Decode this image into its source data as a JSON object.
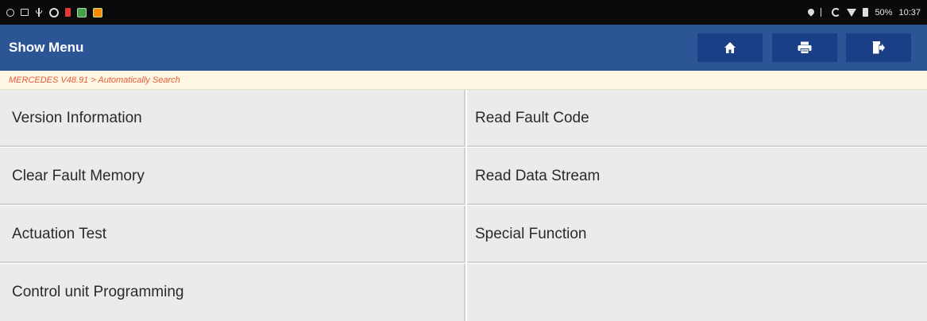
{
  "status_bar": {
    "battery_percent": "50%",
    "time": "10:37",
    "left_icons": [
      "circle-icon",
      "screen-icon",
      "usb-icon",
      "ring-icon",
      "red-battery-icon",
      "green-app-icon",
      "orange-app-icon"
    ],
    "right_icons": [
      "location-pin-icon",
      "bluetooth-icon",
      "sync-icon",
      "wifi-icon",
      "battery-icon"
    ]
  },
  "header": {
    "title": "Show Menu",
    "buttons": [
      {
        "name": "home",
        "icon": "home-icon"
      },
      {
        "name": "print",
        "icon": "print-icon"
      },
      {
        "name": "exit",
        "icon": "exit-icon"
      }
    ],
    "background_color": "#2c5596",
    "button_color": "#1a3f86"
  },
  "breadcrumb": {
    "text": "MERCEDES V48.91 > Automatically Search",
    "color": "#e85a3a"
  },
  "menu": {
    "items": [
      {
        "label": "Version Information"
      },
      {
        "label": "Read Fault Code"
      },
      {
        "label": "Clear Fault Memory"
      },
      {
        "label": "Read Data Stream"
      },
      {
        "label": "Actuation Test"
      },
      {
        "label": "Special Function"
      },
      {
        "label": "Control unit Programming"
      },
      {
        "label": ""
      }
    ]
  }
}
